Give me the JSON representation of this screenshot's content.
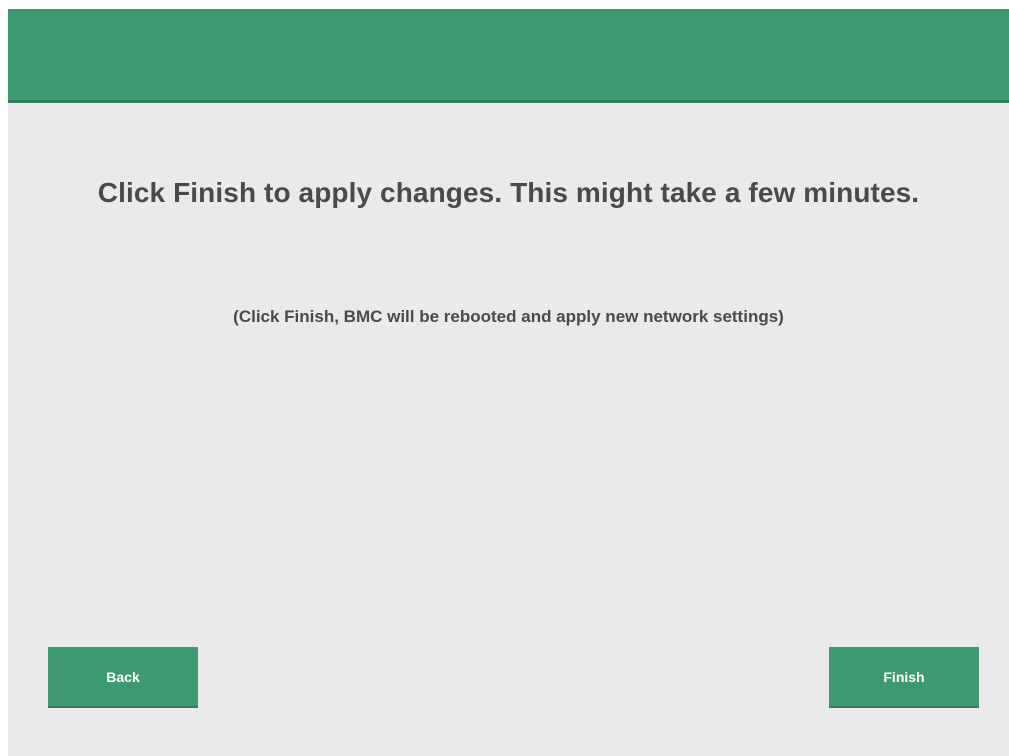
{
  "header": {
    "color": "#3d9970"
  },
  "main": {
    "title": "Click Finish to apply changes. This might take a few minutes.",
    "subtitle": "(Click Finish, BMC will be rebooted and apply new network settings)"
  },
  "footer": {
    "back_label": "Back",
    "finish_label": "Finish"
  },
  "colors": {
    "accent": "#3d9970",
    "background": "#eaeaec",
    "text": "#4a4a4a"
  }
}
